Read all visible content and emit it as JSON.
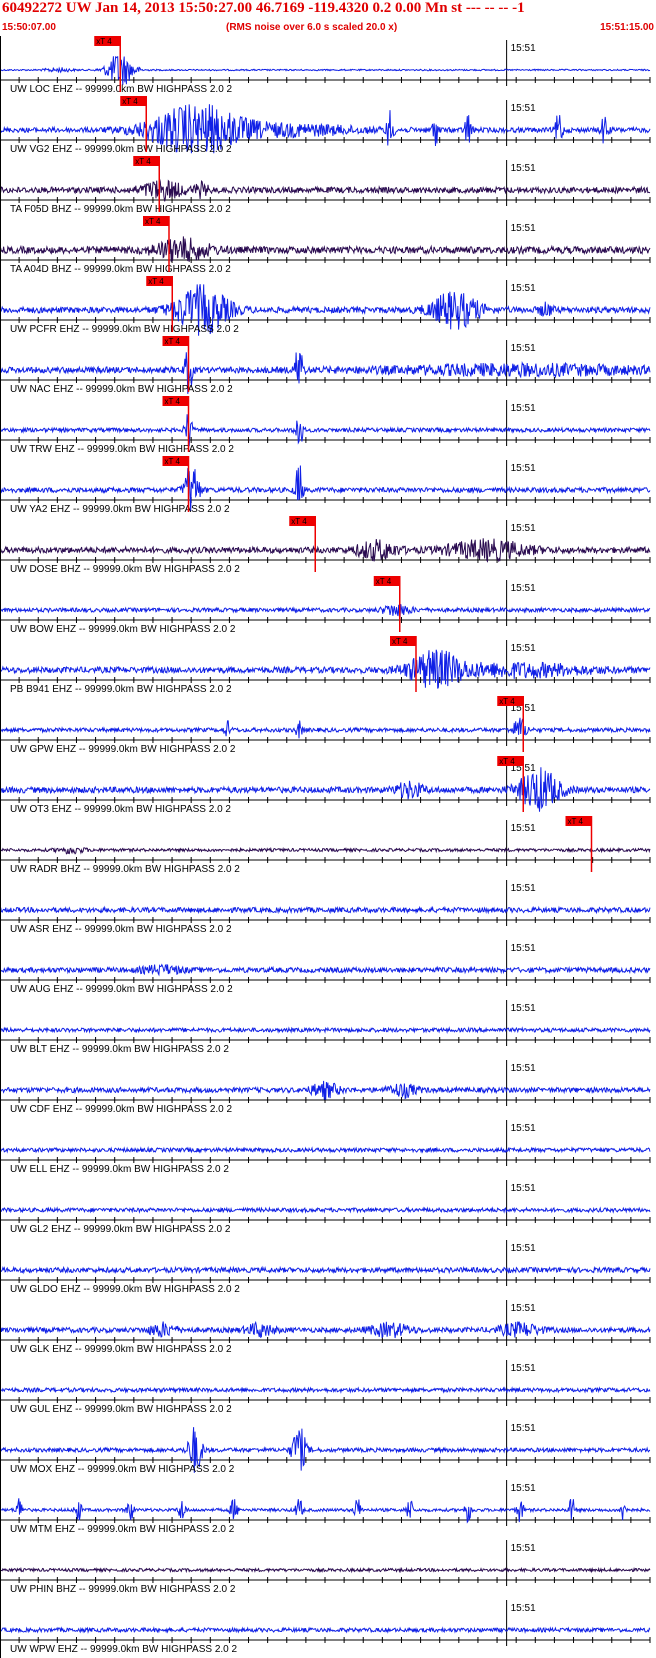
{
  "header": {
    "title": "60492272 UW Jan 14, 2013 15:50:27.00   46.7169 -119.4320  0.2 0.00 Mn st --- -- --  -1",
    "start_time": "15:50:07.00",
    "noise_note": "(RMS noise over 6.0 s scaled 20.0 x)",
    "end_time": "15:51:15.00"
  },
  "colors": {
    "header": "#e00000",
    "trace_blue": "#1020e6",
    "trace_dark": "#2a0b50",
    "pick": "#ee0000",
    "axis": "#000000"
  },
  "chart_data": {
    "type": "line",
    "x_range": [
      "15:50:07.00",
      "15:51:15.00"
    ],
    "minute_mark_label": "15:51",
    "pick_label": "xT 4",
    "traces": [
      {
        "label": "UW LOC EHZ -- 99999.0km BW  HIGHPASS  2.0  2",
        "color": "#1020e6",
        "pick": 0.185,
        "amp": 0.7,
        "bursts": [
          [
            0.09,
            0.02,
            3.0
          ],
          [
            0.185,
            0.02,
            25.0
          ]
        ]
      },
      {
        "label": "UW VG2 EHZ -- 99999.0km BW  HIGHPASS  2.0  2",
        "color": "#1020e6",
        "pick": 0.225,
        "amp": 2.5,
        "bursts": [
          [
            0.3,
            0.07,
            10.0
          ],
          [
            0.45,
            0.1,
            2.0
          ],
          [
            0.6,
            0.005,
            8.0
          ],
          [
            0.67,
            0.005,
            6.0
          ],
          [
            0.72,
            0.005,
            7.0
          ],
          [
            0.86,
            0.005,
            8.0
          ],
          [
            0.93,
            0.005,
            6.0
          ]
        ]
      },
      {
        "label": "TA F05D BHZ -- 99999.0km BW  HIGHPASS  2.0  2",
        "color": "#2a0b50",
        "pick": 0.245,
        "amp": 3.0,
        "bursts": [
          [
            0.25,
            0.03,
            3.0
          ],
          [
            0.31,
            0.01,
            2.0
          ]
        ]
      },
      {
        "label": "TA A04D BHZ -- 99999.0km BW  HIGHPASS  2.0  2",
        "color": "#2a0b50",
        "pick": 0.26,
        "amp": 3.5,
        "bursts": [
          [
            0.28,
            0.04,
            3.0
          ]
        ]
      },
      {
        "label": "UW PCFR EHZ -- 99999.0km BW  HIGHPASS  2.0  2",
        "color": "#1020e6",
        "pick": 0.265,
        "amp": 3.0,
        "bursts": [
          [
            0.31,
            0.04,
            8.0
          ],
          [
            0.7,
            0.035,
            6.0
          ],
          [
            0.84,
            0.01,
            2.0
          ]
        ]
      },
      {
        "label": "UW NAC EHZ -- 99999.0km BW  HIGHPASS  2.0  2",
        "color": "#1020e6",
        "pick": 0.29,
        "amp": 3.0,
        "bursts": [
          [
            0.29,
            0.005,
            10.0
          ],
          [
            0.46,
            0.005,
            12.0
          ],
          [
            0.8,
            0.2,
            1.5
          ]
        ]
      },
      {
        "label": "UW TRW EHZ -- 99999.0km BW  HIGHPASS  2.0  2",
        "color": "#1020e6",
        "pick": 0.29,
        "amp": 2.0,
        "bursts": [
          [
            0.29,
            0.005,
            10.0
          ],
          [
            0.46,
            0.005,
            12.0
          ]
        ]
      },
      {
        "label": "UW YA2 EHZ -- 99999.0km BW  HIGHPASS  2.0  2",
        "color": "#1020e6",
        "pick": 0.29,
        "amp": 2.5,
        "bursts": [
          [
            0.295,
            0.01,
            12.0
          ],
          [
            0.46,
            0.005,
            12.0
          ]
        ]
      },
      {
        "label": "UW DOSE BHZ -- 99999.0km BW  HIGHPASS  2.0  2",
        "color": "#2a0b50",
        "pick": 0.485,
        "amp": 3.0,
        "bursts": [
          [
            0.58,
            0.03,
            3.0
          ],
          [
            0.75,
            0.06,
            3.0
          ]
        ]
      },
      {
        "label": "UW BOW EHZ -- 99999.0km BW  HIGHPASS  2.0  2",
        "color": "#1020e6",
        "pick": 0.615,
        "amp": 2.0,
        "bursts": [
          [
            0.61,
            0.02,
            3.0
          ]
        ]
      },
      {
        "label": "PB B941 EHZ -- 99999.0km BW  HIGHPASS  2.0  2",
        "color": "#1020e6",
        "pick": 0.64,
        "amp": 3.0,
        "bursts": [
          [
            0.67,
            0.04,
            6.0
          ],
          [
            0.8,
            0.1,
            2.0
          ]
        ]
      },
      {
        "label": "UW GPW EHZ -- 99999.0km BW  HIGHPASS  2.0  2",
        "color": "#1020e6",
        "pick": 0.805,
        "amp": 2.0,
        "bursts": [
          [
            0.8,
            0.01,
            6.0
          ],
          [
            0.35,
            0.005,
            4.0
          ],
          [
            0.46,
            0.005,
            4.0
          ]
        ]
      },
      {
        "label": "UW OT3 EHZ -- 99999.0km BW  HIGHPASS  2.0  2",
        "color": "#1020e6",
        "pick": 0.805,
        "amp": 3.0,
        "bursts": [
          [
            0.83,
            0.03,
            7.0
          ],
          [
            0.63,
            0.02,
            2.5
          ]
        ]
      },
      {
        "label": "UW RADR BHZ -- 99999.0km BW  HIGHPASS  2.0  2",
        "color": "#2a0b50",
        "pick": 0.91,
        "amp": 1.5,
        "bursts": [
          [
            0.11,
            0.02,
            2.0
          ]
        ]
      },
      {
        "label": "UW ASR EHZ -- 99999.0km BW  HIGHPASS  2.0  2",
        "color": "#1020e6",
        "pick": null,
        "amp": 2.5,
        "bursts": []
      },
      {
        "label": "UW AUG EHZ -- 99999.0km BW  HIGHPASS  2.0  2",
        "color": "#1020e6",
        "pick": null,
        "amp": 2.5,
        "bursts": [
          [
            0.25,
            0.03,
            1.5
          ]
        ]
      },
      {
        "label": "UW BLT EHZ -- 99999.0km BW  HIGHPASS  2.0  2",
        "color": "#1020e6",
        "pick": null,
        "amp": 2.0,
        "bursts": []
      },
      {
        "label": "UW CDF EHZ -- 99999.0km BW  HIGHPASS  2.0  2",
        "color": "#1020e6",
        "pick": null,
        "amp": 2.5,
        "bursts": [
          [
            0.5,
            0.02,
            3.0
          ],
          [
            0.62,
            0.02,
            2.5
          ]
        ]
      },
      {
        "label": "UW ELL EHZ -- 99999.0km BW  HIGHPASS  2.0  2",
        "color": "#1020e6",
        "pick": null,
        "amp": 2.0,
        "bursts": []
      },
      {
        "label": "UW GL2 EHZ -- 99999.0km BW  HIGHPASS  2.0  2",
        "color": "#1020e6",
        "pick": null,
        "amp": 2.0,
        "bursts": []
      },
      {
        "label": "UW GLDO EHZ -- 99999.0km BW  HIGHPASS  2.0  2",
        "color": "#1020e6",
        "pick": null,
        "amp": 2.5,
        "bursts": []
      },
      {
        "label": "UW GLK EHZ -- 99999.0km BW  HIGHPASS  2.0  2",
        "color": "#1020e6",
        "pick": null,
        "amp": 2.5,
        "bursts": [
          [
            0.25,
            0.02,
            2.5
          ],
          [
            0.4,
            0.02,
            2.5
          ],
          [
            0.6,
            0.03,
            2.5
          ],
          [
            0.8,
            0.03,
            2.5
          ]
        ]
      },
      {
        "label": "UW GUL EHZ -- 99999.0km BW  HIGHPASS  2.0  2",
        "color": "#1020e6",
        "pick": null,
        "amp": 2.0,
        "bursts": []
      },
      {
        "label": "UW MOX EHZ -- 99999.0km BW  HIGHPASS  2.0  2",
        "color": "#1020e6",
        "pick": null,
        "amp": 2.0,
        "bursts": [
          [
            0.3,
            0.01,
            12.0
          ],
          [
            0.46,
            0.01,
            12.0
          ]
        ]
      },
      {
        "label": "UW MTM EHZ -- 99999.0km BW  HIGHPASS  2.0  2",
        "color": "#1020e6",
        "pick": null,
        "amp": 1.5,
        "bursts": [
          [
            0.03,
            0.005,
            8.0
          ],
          [
            0.12,
            0.005,
            8.0
          ],
          [
            0.2,
            0.005,
            8.0
          ],
          [
            0.28,
            0.005,
            8.0
          ],
          [
            0.36,
            0.005,
            8.0
          ],
          [
            0.46,
            0.005,
            8.0
          ],
          [
            0.55,
            0.005,
            8.0
          ],
          [
            0.63,
            0.005,
            8.0
          ],
          [
            0.72,
            0.005,
            8.0
          ],
          [
            0.8,
            0.005,
            8.0
          ],
          [
            0.88,
            0.005,
            8.0
          ],
          [
            0.96,
            0.005,
            8.0
          ]
        ]
      },
      {
        "label": "UW PHIN BHZ -- 99999.0km BW  HIGHPASS  2.0  2",
        "color": "#2a0b50",
        "pick": null,
        "amp": 1.5,
        "bursts": []
      },
      {
        "label": "UW WPW EHZ -- 99999.0km BW  HIGHPASS  2.0  2",
        "color": "#1020e6",
        "pick": null,
        "amp": 2.0,
        "bursts": []
      }
    ]
  }
}
